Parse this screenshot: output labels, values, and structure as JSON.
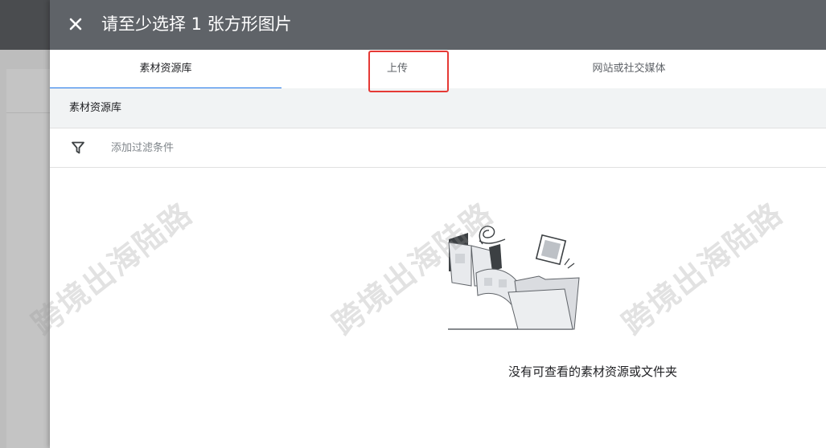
{
  "dialog": {
    "title": "请至少选择 1 张方形图片",
    "close_icon": "close-icon"
  },
  "tabs": [
    {
      "label": "素材资源库",
      "selected": true
    },
    {
      "label": "上传",
      "selected": false
    },
    {
      "label": "网站或社交媒体",
      "selected": false
    }
  ],
  "breadcrumb": "素材资源库",
  "filter": {
    "icon": "filter-icon",
    "placeholder": "添加过滤条件"
  },
  "empty_state": {
    "illustration": "empty-folder-illustration",
    "message": "没有可查看的素材资源或文件夹"
  },
  "watermark": "跨境出海陆路",
  "colors": {
    "header_bg": "#5f6368",
    "tab_indicator": "#1a73e8",
    "highlight": "#e53935",
    "crumb_bg": "#f1f3f4"
  }
}
